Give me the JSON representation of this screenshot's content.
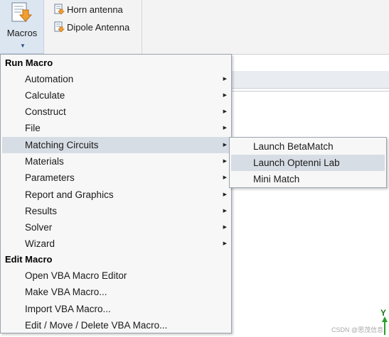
{
  "ribbon": {
    "macros_label": "Macros",
    "items": [
      {
        "label": "Horn antenna",
        "icon": "macro-script-icon"
      },
      {
        "label": "Dipole Antenna",
        "icon": "macro-script-icon"
      }
    ]
  },
  "menu": {
    "run_header": "Run Macro",
    "run_items": [
      {
        "label": "Automation"
      },
      {
        "label": "Calculate"
      },
      {
        "label": "Construct"
      },
      {
        "label": "File"
      },
      {
        "label": "Matching Circuits"
      },
      {
        "label": "Materials"
      },
      {
        "label": "Parameters"
      },
      {
        "label": "Report and Graphics"
      },
      {
        "label": "Results"
      },
      {
        "label": "Solver"
      },
      {
        "label": "Wizard"
      }
    ],
    "edit_header": "Edit Macro",
    "edit_items": [
      {
        "label": "Open VBA Macro Editor"
      },
      {
        "label": "Make VBA Macro..."
      },
      {
        "label": "Import VBA Macro..."
      },
      {
        "label": "Edit / Move / Delete VBA Macro..."
      }
    ]
  },
  "submenu": {
    "items": [
      {
        "label": "Launch BetaMatch"
      },
      {
        "label": "Launch Optenni Lab"
      },
      {
        "label": "Mini Match"
      }
    ]
  },
  "canvas": {
    "axis_label": "Y",
    "watermark": "CSDN @思茂信息"
  },
  "colors": {
    "highlight": "#d7dde4",
    "macros_button_bg": "#dce6f1",
    "axis_green": "#1a7a1a"
  }
}
